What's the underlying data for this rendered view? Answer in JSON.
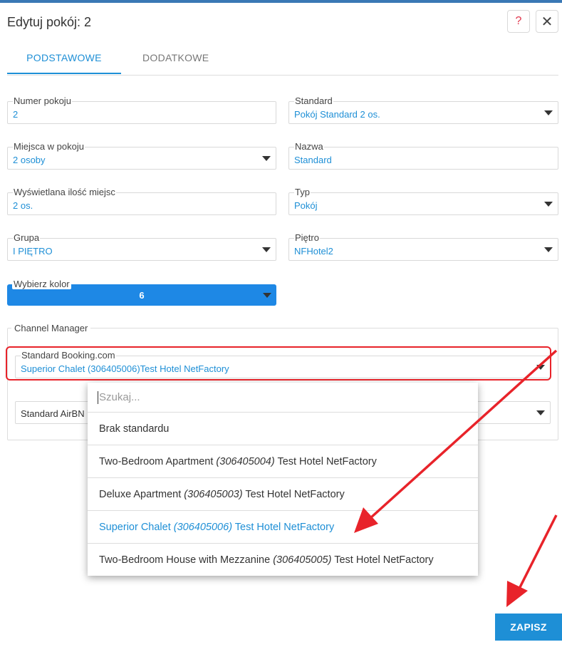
{
  "dialog": {
    "title": "Edytuj pokój: 2",
    "help_label": "?",
    "close_label": "✕"
  },
  "tabs": [
    {
      "label": "PODSTAWOWE",
      "active": true
    },
    {
      "label": "DODATKOWE",
      "active": false
    }
  ],
  "fields": {
    "room_number": {
      "label": "Numer pokoju",
      "value": "2"
    },
    "standard": {
      "label": "Standard",
      "value": "Pokój Standard 2 os."
    },
    "places": {
      "label": "Miejsca w pokoju",
      "value": "2 osoby"
    },
    "name": {
      "label": "Nazwa",
      "value": "Standard"
    },
    "displayed_places": {
      "label": "Wyświetlana ilość miejsc",
      "value": "2 os."
    },
    "type": {
      "label": "Typ",
      "value": "Pokój"
    },
    "group": {
      "label": "Grupa",
      "value": "I PIĘTRO"
    },
    "floor": {
      "label": "Piętro",
      "value": "NFHotel2"
    },
    "color": {
      "label": "Wybierz kolor",
      "value": "6",
      "color": "#1e88e5"
    }
  },
  "channel_manager": {
    "title": "Channel Manager",
    "booking": {
      "label": "Standard Booking.com",
      "value": "Superior Chalet (306405006)Test Hotel NetFactory"
    },
    "airbnb": {
      "label": "Standard AirBN"
    }
  },
  "dropdown": {
    "search_placeholder": "Szukaj...",
    "options": [
      {
        "plain": "Brak standardu",
        "id": "",
        "suffix": "",
        "selected": false
      },
      {
        "plain": "Two-Bedroom Apartment ",
        "id": "(306405004)",
        "suffix": " Test Hotel NetFactory",
        "selected": false
      },
      {
        "plain": "Deluxe Apartment ",
        "id": "(306405003)",
        "suffix": " Test Hotel NetFactory",
        "selected": false
      },
      {
        "plain": "Superior Chalet ",
        "id": "(306405006)",
        "suffix": " Test Hotel NetFactory",
        "selected": true
      },
      {
        "plain": "Two-Bedroom House with Mezzanine ",
        "id": "(306405005)",
        "suffix": " Test Hotel NetFactory",
        "selected": false
      }
    ]
  },
  "footer": {
    "save_label": "ZAPISZ"
  },
  "colors": {
    "accent": "#1e8fd6",
    "highlight": "#e8232a",
    "help": "#e0344b"
  }
}
